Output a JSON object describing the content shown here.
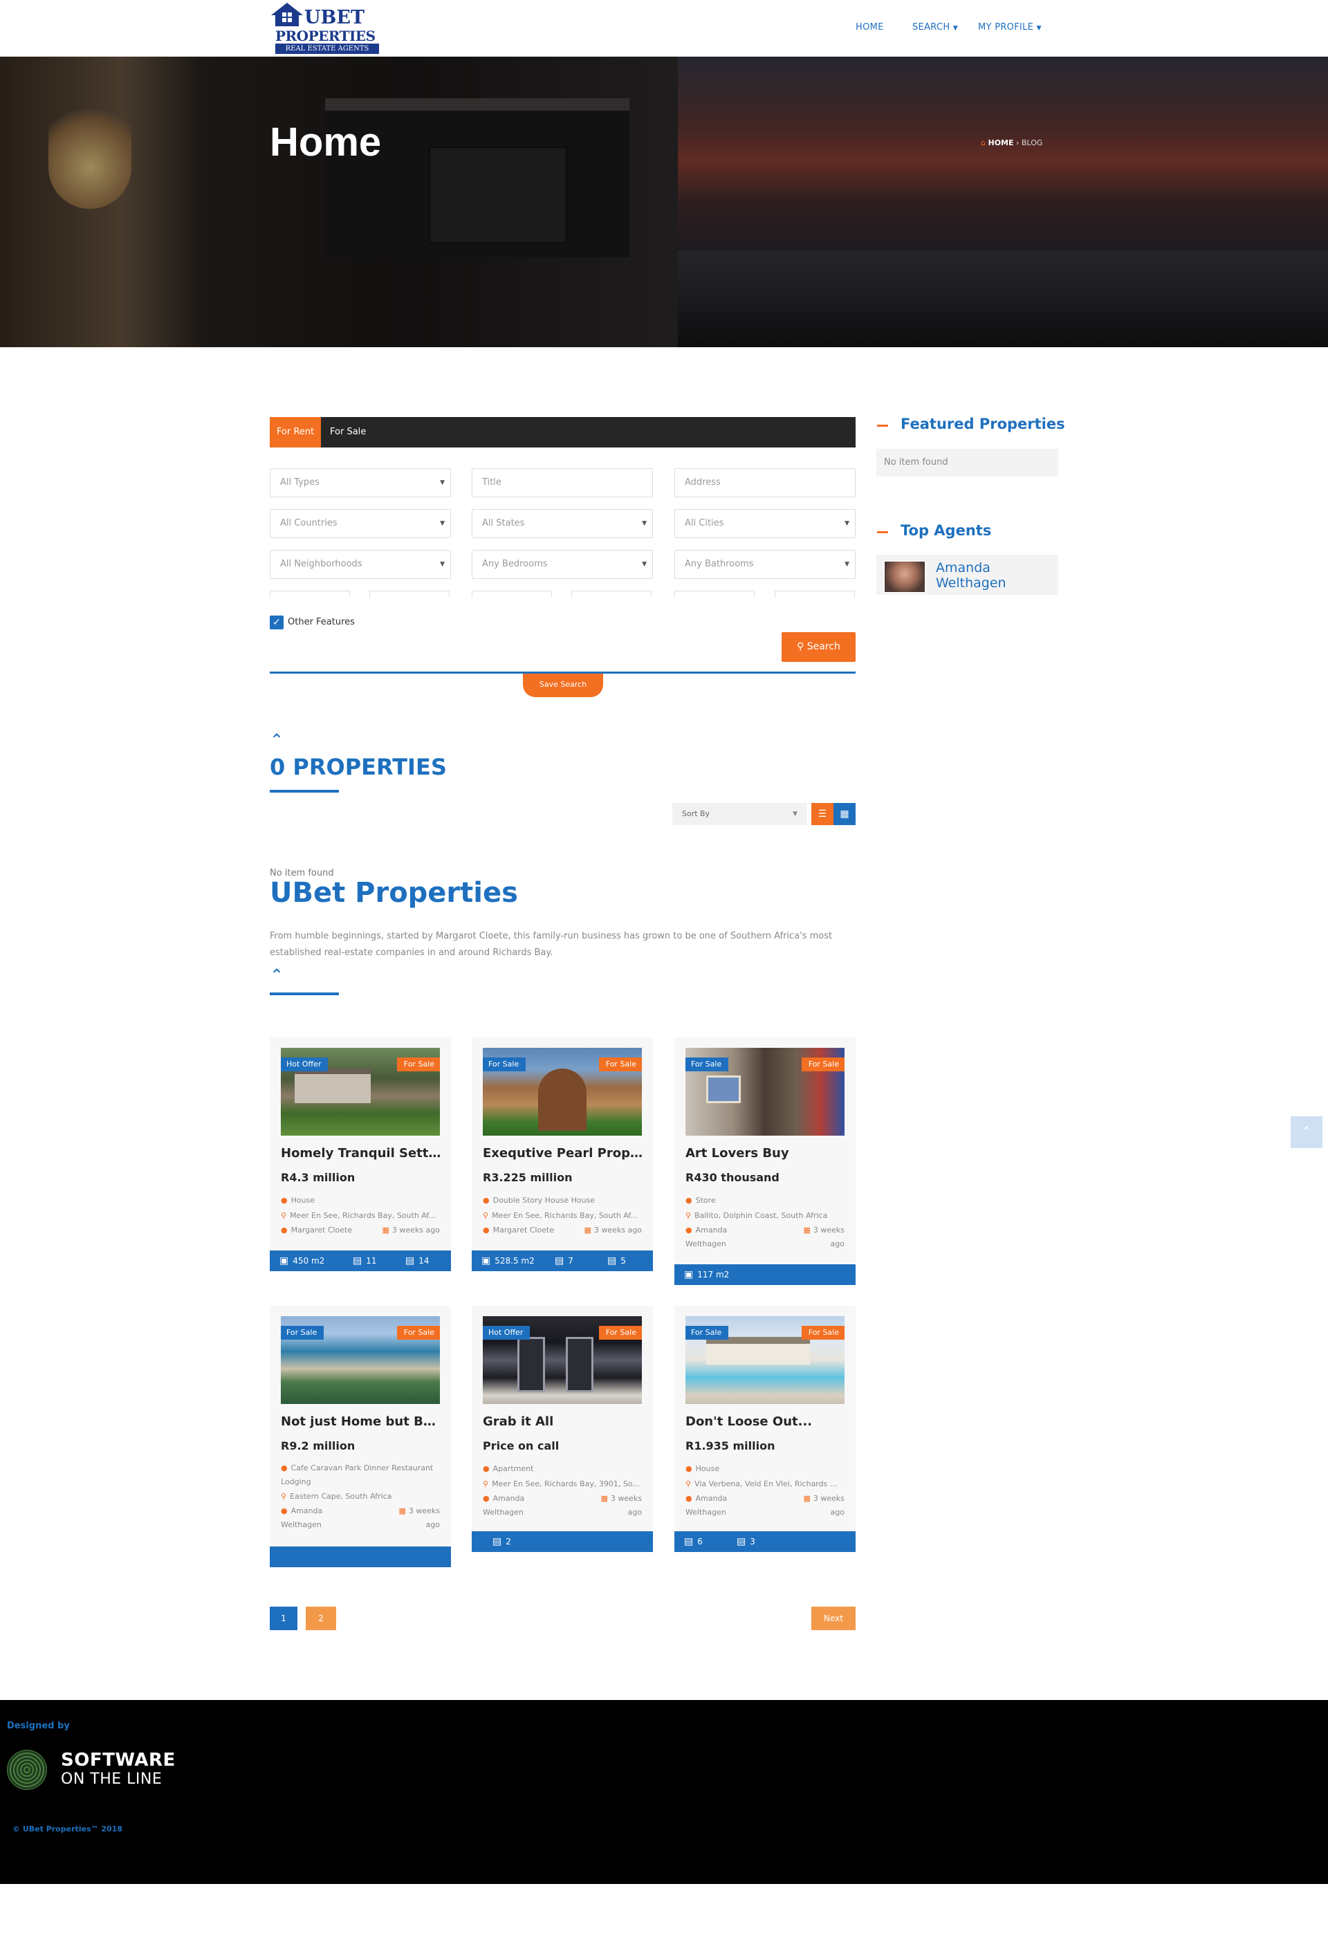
{
  "header": {
    "logo": {
      "line1": "UBET",
      "line2": "PROPERTIES",
      "line3": "REAL ESTATE AGENTS"
    },
    "nav": [
      {
        "label": "HOME"
      },
      {
        "label": "SEARCH"
      },
      {
        "label": "MY PROFILE"
      }
    ]
  },
  "hero": {
    "title": "Home",
    "breadcrumb": {
      "home": "HOME",
      "sep": "›",
      "current": "BLOG"
    }
  },
  "search": {
    "tabs": [
      "For Rent",
      "For Sale"
    ],
    "fields": {
      "types": "All Types",
      "title": "Title",
      "address": "Address",
      "countries": "All Countries",
      "states": "All States",
      "cities": "All Cities",
      "neighborhoods": "All Neighborhoods",
      "bedrooms": "Any Bedrooms",
      "bathrooms": "Any Bathrooms"
    },
    "other_features": "Other Features",
    "search_button": "Search",
    "save_search": "Save Search"
  },
  "sidebar": {
    "featured_title": "Featured Properties",
    "featured_empty": "No item found",
    "agents_title": "Top Agents",
    "agent_name_1": "Amanda",
    "agent_name_2": "Welthagen"
  },
  "listing": {
    "count_label": "0 PROPERTIES",
    "sort_label": "Sort By",
    "no_item": "No item found"
  },
  "company": {
    "title": "UBet Properties",
    "description": "From humble beginnings, started by Margarot Cloete, this family-run business has grown to be one of Southern Africa's most established real-estate companies in and around Richards Bay."
  },
  "cards": [
    {
      "badge_left": "Hot Offer",
      "badge_right": "For Sale",
      "title": "Homely Tranquil Setting...",
      "price": "R4.3 million",
      "type": "House",
      "location": "Meer En See, Richards Bay, South Af...",
      "agent": "Margaret Cloete",
      "time": "3 weeks ago",
      "area": "450 m2",
      "beds": "11",
      "baths": "14"
    },
    {
      "badge_left": "For Sale",
      "badge_right": "For Sale",
      "title": "Exequtive Pearl Property",
      "price": "R3.225 million",
      "type": "Double Story House House",
      "location": "Meer En See, Richards Bay, South Af...",
      "agent": "Margaret Cloete",
      "time": "3 weeks ago",
      "area": "528.5 m2",
      "beds": "7",
      "baths": "5"
    },
    {
      "badge_left": "For Sale",
      "badge_right": "For Sale",
      "title": "Art Lovers Buy",
      "price": "R430 thousand",
      "type": "Store",
      "location": "Ballito, Dolphin Coast, South Africa",
      "agent_1": "Amanda",
      "agent_2": "Welthagen",
      "time_1": "3 weeks",
      "time_2": "ago",
      "area": "117 m2"
    },
    {
      "badge_left": "For Sale",
      "badge_right": "For Sale",
      "title": "Not just Home but Busin...",
      "price": "R9.2 million",
      "type": "Cafe Caravan Park Dinner Restaurant Lodging",
      "location": "Eastern Cape, South Africa",
      "agent_1": "Amanda",
      "agent_2": "Welthagen",
      "time_1": "3 weeks",
      "time_2": "ago"
    },
    {
      "badge_left": "Hot Offer",
      "badge_right": "For Sale",
      "title": "Grab it All",
      "price": "Price on call",
      "type": "Apartment",
      "location": "Meer En See, Richards Bay, 3901, So...",
      "agent_1": "Amanda",
      "agent_2": "Welthagen",
      "time_1": "3 weeks",
      "time_2": "ago",
      "baths": "2"
    },
    {
      "badge_left": "For Sale",
      "badge_right": "For Sale",
      "title": "Don't Loose Out...",
      "price": "R1.935 million",
      "type": "House",
      "location": "Via Verbena, Veld En Vlei, Richards ...",
      "agent_1": "Amanda",
      "agent_2": "Welthagen",
      "time_1": "3 weeks",
      "time_2": "ago",
      "beds": "6",
      "baths": "3"
    }
  ],
  "pagination": {
    "pages": [
      "1",
      "2"
    ],
    "next": "Next"
  },
  "footer": {
    "designed_by": "Designed by",
    "brand_line1": "SOFTWARE",
    "brand_line2": "ON THE LINE",
    "copyright": "© UBet Properties™ 2018"
  },
  "icons": {
    "dropdown": "chevron-down-icon",
    "check": "check-icon",
    "search": "search-icon",
    "tag": "tag-icon",
    "pin": "map-pin-icon",
    "user": "user-icon",
    "calendar": "calendar-icon",
    "area": "area-icon",
    "bed": "bed-icon",
    "bath": "bath-icon",
    "scroll_top": "chevron-up-icon"
  },
  "colors": {
    "brand_blue": "#1e70bf",
    "accent_orange": "#f36f21",
    "dark": "#262626"
  }
}
